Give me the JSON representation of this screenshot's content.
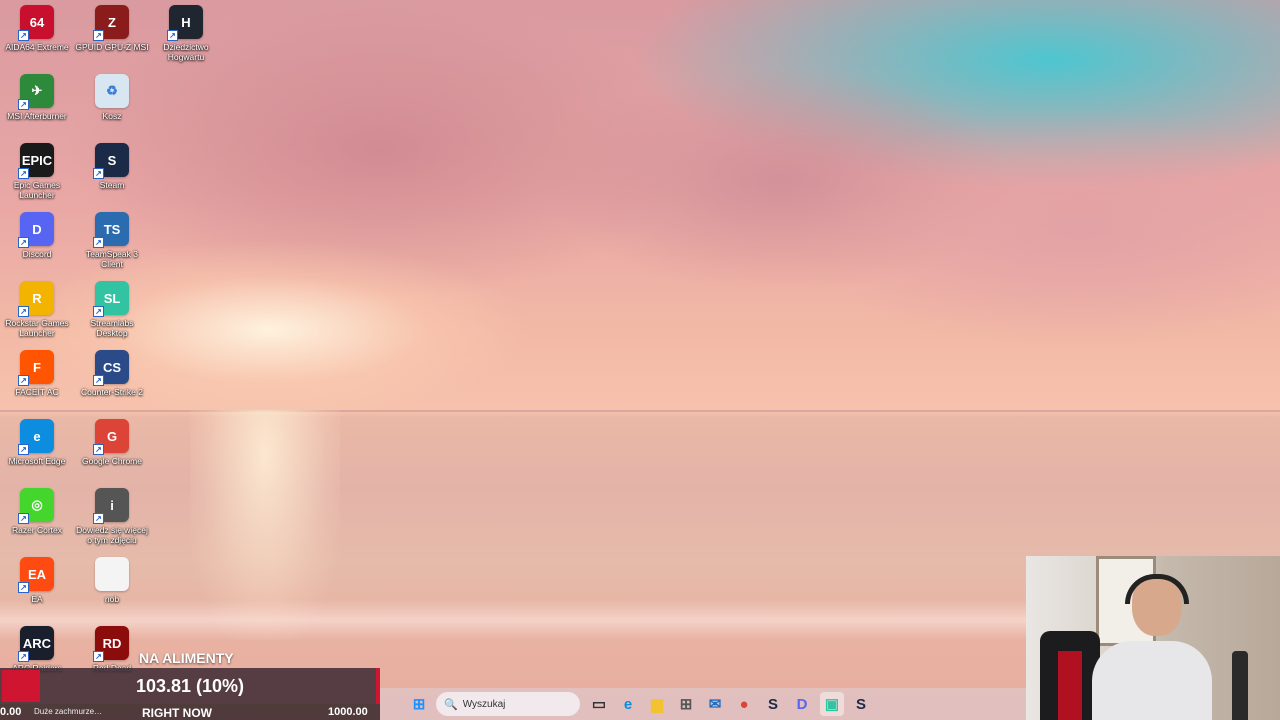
{
  "desktop": {
    "icons": [
      {
        "label": "AIDA64 Extreme",
        "glyph": "64",
        "color": "#c8102e",
        "icon": "aida64-icon"
      },
      {
        "label": "GPUID GPU-Z MSI",
        "glyph": "Z",
        "color": "#8a1c1c",
        "icon": "gpuz-icon"
      },
      {
        "label": "Dziedzictwo Hogwartu",
        "glyph": "H",
        "color": "#1f2630",
        "icon": "hogwarts-legacy-icon"
      },
      {
        "label": "MSI Afterburner",
        "glyph": "✈",
        "color": "#2c8a3a",
        "icon": "msi-afterburner-icon"
      },
      {
        "label": "Kosz",
        "glyph": "♻",
        "color": "#d8e6f2",
        "icon": "recycle-bin-icon"
      },
      {
        "label": "Epic Games Launcher",
        "glyph": "EPIC",
        "color": "#1a1a1a",
        "icon": "epic-games-icon"
      },
      {
        "label": "Steam",
        "glyph": "S",
        "color": "#1b2b47",
        "icon": "steam-icon"
      },
      {
        "label": "Discord",
        "glyph": "D",
        "color": "#5865f2",
        "icon": "discord-icon"
      },
      {
        "label": "TeamSpeak 3 Client",
        "glyph": "TS",
        "color": "#2b6cb0",
        "icon": "teamspeak-icon"
      },
      {
        "label": "Rockstar Games Launcher",
        "glyph": "R",
        "color": "#f2b400",
        "icon": "rockstar-icon"
      },
      {
        "label": "Streamlabs Desktop",
        "glyph": "SL",
        "color": "#31c3a2",
        "icon": "streamlabs-icon"
      },
      {
        "label": "FACEIT AC",
        "glyph": "F",
        "color": "#ff5500",
        "icon": "faceit-icon"
      },
      {
        "label": "Counter-Strike 2",
        "glyph": "CS",
        "color": "#2a4a88",
        "icon": "counter-strike-icon"
      },
      {
        "label": "Microsoft Edge",
        "glyph": "e",
        "color": "#0c8de0",
        "icon": "edge-icon"
      },
      {
        "label": "Google Chrome",
        "glyph": "G",
        "color": "#db4437",
        "icon": "chrome-icon"
      },
      {
        "label": "Razer Cortex",
        "glyph": "◎",
        "color": "#44d62c",
        "icon": "razer-cortex-icon"
      },
      {
        "label": "Dowiedz się więcej o tym zdjęciu",
        "glyph": "i",
        "color": "#555555",
        "icon": "spotlight-info-icon"
      },
      {
        "label": "EA",
        "glyph": "EA",
        "color": "#ff4a12",
        "icon": "ea-icon"
      },
      {
        "label": "nob",
        "glyph": "",
        "color": "#f4f4f4",
        "icon": "file-icon"
      },
      {
        "label": "ARC Raiders",
        "glyph": "ARC",
        "color": "#1a1f2e",
        "icon": "arc-raiders-icon"
      },
      {
        "label": "Red Dead",
        "glyph": "RD",
        "color": "#8c0c0c",
        "icon": "red-dead-icon"
      }
    ]
  },
  "overlay": {
    "goal_title": "NA ALIMENTY",
    "goal_value": "103.81 (10%)",
    "progress_fraction": 0.1,
    "min_label": "0.00",
    "latest_text": "Duże zachmurze…",
    "now_label": "RIGHT NOW",
    "max_label": "1000.00",
    "accent_color": "#d01530"
  },
  "taskbar": {
    "search_placeholder": "Wyszukaj",
    "items": [
      {
        "icon": "windows-start-icon",
        "glyph": "⊞",
        "color": "#1e90ff"
      },
      {
        "icon": "task-view-icon",
        "glyph": "▭",
        "color": "#333333"
      },
      {
        "icon": "edge-icon",
        "glyph": "e",
        "color": "#0c8de0"
      },
      {
        "icon": "file-explorer-icon",
        "glyph": "▆",
        "color": "#f2c230"
      },
      {
        "icon": "microsoft-store-icon",
        "glyph": "⊞",
        "color": "#555555"
      },
      {
        "icon": "outlook-icon",
        "glyph": "✉",
        "color": "#1c6dc7"
      },
      {
        "icon": "chrome-icon",
        "glyph": "●",
        "color": "#db4437"
      },
      {
        "icon": "steam-icon",
        "glyph": "S",
        "color": "#1b2b47"
      },
      {
        "icon": "discord-icon",
        "glyph": "D",
        "color": "#5865f2"
      },
      {
        "icon": "streamlabs-icon",
        "glyph": "▣",
        "color": "#31c3a2"
      },
      {
        "icon": "steam-icon",
        "glyph": "S",
        "color": "#1b2b47"
      }
    ]
  }
}
